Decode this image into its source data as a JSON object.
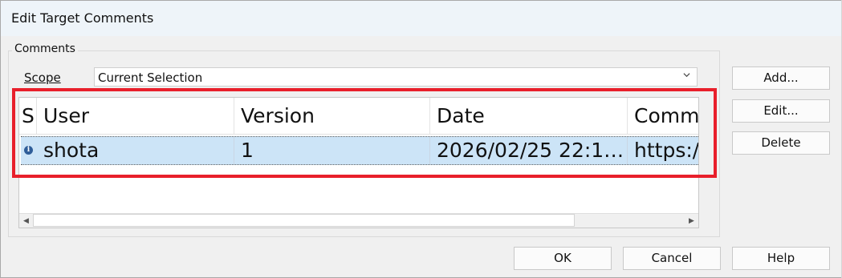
{
  "dialog": {
    "title": "Edit Target Comments"
  },
  "comments_group": {
    "label": "Comments",
    "scope_label": "Scope",
    "scope_value": "Current Selection"
  },
  "list": {
    "columns": [
      {
        "label": "S"
      },
      {
        "label": "User"
      },
      {
        "label": "Version"
      },
      {
        "label": "Date"
      },
      {
        "label": "Comm"
      }
    ],
    "rows": [
      {
        "icon": "info-icon",
        "user": "shota",
        "version": "1",
        "date": "2026/02/25 22:1…",
        "comment": "https:/"
      }
    ]
  },
  "side_buttons": {
    "add_label": "Add...",
    "edit_label": "Edit...",
    "delete_label": "Delete"
  },
  "footer_buttons": {
    "ok_label": "OK",
    "cancel_label": "Cancel",
    "help_label": "Help"
  },
  "colors": {
    "selection": "#cce4f7",
    "highlight_box": "#e81f2b",
    "info_icon": "#2f5e99"
  }
}
